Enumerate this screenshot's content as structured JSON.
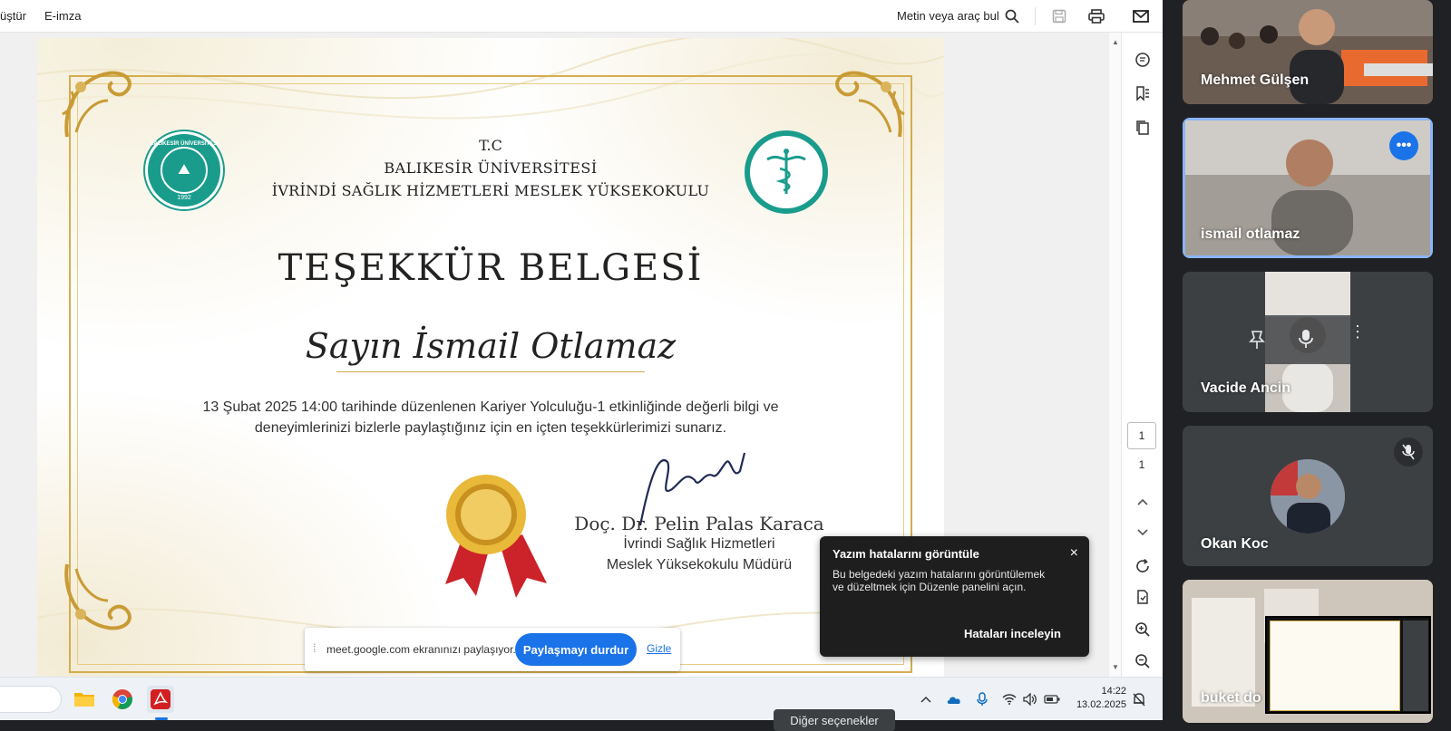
{
  "toolbar": {
    "left_item_1": "üştür",
    "left_item_2": "E-imza",
    "search_label": "Metin veya araç bul"
  },
  "certificate": {
    "tc": "T.C",
    "university": "BALIKESİR ÜNİVERSİTESİ",
    "school": "İVRİNDİ SAĞLIK HİZMETLERİ MESLEK YÜKSEKOKULU",
    "seal_left_text": "BALIKESİR ÜNİVERSİTESİ",
    "seal_left_year": "1992",
    "title": "TEŞEKKÜR BELGESİ",
    "recipient": "Sayın İsmail Otlamaz",
    "body_line_1": "13 Şubat 2025 14:00 tarihinde düzenlenen Kariyer Yolculuğu-1 etkinliğinde değerli bilgi ve",
    "body_line_2": "deneyimlerinizi bizlerle paylaştığınız için en içten teşekkürlerimizi sunarız.",
    "signer_name": "Doç. Dr. Pelin Palas Karaca",
    "signer_title_1": "İvrindi Sağlık Hizmetleri",
    "signer_title_2": "Meslek Yüksekokulu Müdürü"
  },
  "pager": {
    "current_page": "1",
    "total_pages": "1"
  },
  "popup": {
    "title": "Yazım hatalarını görüntüle",
    "body": "Bu belgedeki yazım hatalarını görüntülemek ve düzeltmek için Düzenle panelini açın.",
    "close": "×",
    "action": "Hataları inceleyin"
  },
  "sharebar": {
    "message": "meet.google.com ekranınızı paylaşıyor.",
    "stop_button": "Paylaşmayı durdur",
    "hide_link": "Gizle"
  },
  "taskbar": {
    "time": "14:22",
    "date": "13.02.2025"
  },
  "tooltip": "Diğer seçenekler",
  "participants": [
    {
      "name": "Mehmet Gülşen"
    },
    {
      "name": "ismail otlamaz"
    },
    {
      "name": "Vacide Ancin"
    },
    {
      "name": "Okan Koc"
    },
    {
      "name": "buket do"
    }
  ],
  "colors": {
    "gold": "#d4ad4e",
    "teal": "#1a9c8c",
    "meet_blue": "#1a73e8",
    "active_tile": "#8ab4f8"
  }
}
